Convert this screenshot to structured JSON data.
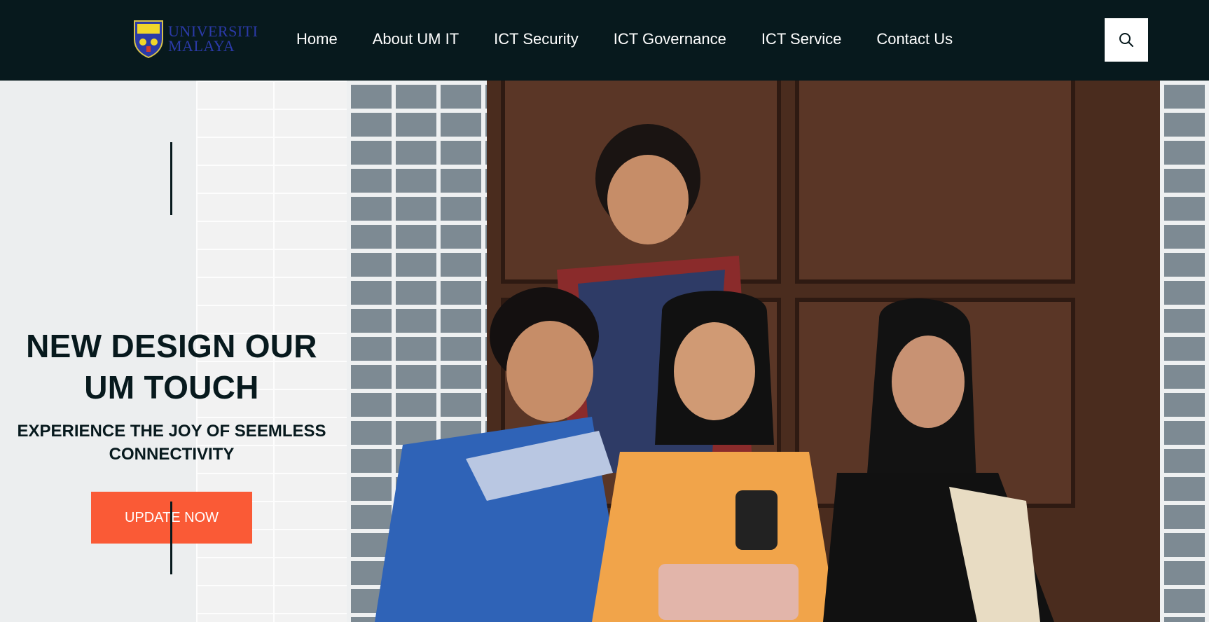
{
  "header": {
    "logo_text_line1": "UNIVERSITI",
    "logo_text_line2": "MALAYA",
    "nav": [
      "Home",
      "About UM IT",
      "ICT Security",
      "ICT Governance",
      "ICT Service",
      "Contact Us"
    ],
    "search_icon": "search-icon"
  },
  "hero": {
    "title_line1": "NEW DESIGN OUR",
    "title_line2": "UM TOUCH",
    "subtitle_line1": "EXPERIENCE THE JOY OF SEEMLESS",
    "subtitle_line2": "CONNECTIVITY",
    "cta_label": "UPDATE NOW"
  },
  "colors": {
    "header_bg": "#07191d",
    "accent": "#fa5a36",
    "text_dark": "#07191d"
  }
}
